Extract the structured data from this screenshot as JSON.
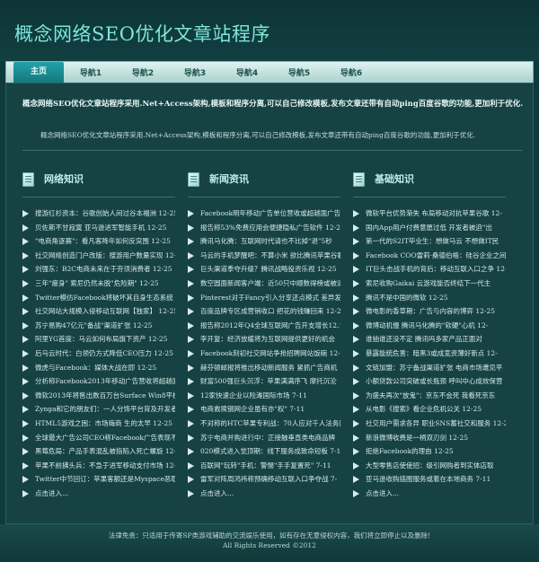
{
  "site": {
    "title": "概念网络SEO优化文章站程序"
  },
  "nav": [
    {
      "label": "主页",
      "active": true
    },
    {
      "label": "导航1"
    },
    {
      "label": "导航2"
    },
    {
      "label": "导航3"
    },
    {
      "label": "导航4"
    },
    {
      "label": "导航5"
    },
    {
      "label": "导航6"
    }
  ],
  "intro": {
    "bold": "概念网络SEO优化文章站程序采用.Net+Access架构,模板和程序分离,可以自己修改模板,发布文章还带有自动ping百度谷歌的功能,更加利于优化.",
    "plain": "概念网络SEO优化文章站程序采用.Net+Access架构,模板和程序分离,可以自己修改模板,发布文章还带有自动ping百度谷歌的功能,更加利于优化."
  },
  "columns": [
    {
      "title": "网络知识",
      "items": [
        "搜游红杉资本：谷歌创始人间过谷本福洲 12-25",
        "贝佐斯不甘寂寞 亚马逊进军智能手机 12-25",
        "\"电商角逐赛\"：看凡客降年如何反突围 12-25",
        "社交网络创造门户改版：搜游用户数量实现 12-",
        "刘强东：B2C电商未来在于夯须消费者 12-25",
        "三年\"瘦身\" 索尼仍然未脱\"危险期\" 12-25",
        "Twitter模仿Facebook将破坏其自身生态系统",
        "社交网站大规模入侵移动互联网【独家】 12-25",
        "苏宁易购47亿元\"备战\"渠道扩张 12-25",
        "阿里YG首度：马云如何布局旗下资产 12-25",
        "后马云时代：白领仍方式降低CEO压力 12-25",
        "微虎与Facebook：媒体大战在即 12-25",
        "分析称Facebook2013年移动广告营收将超越面",
        "微软2013年将售出数百万台Surface Win8平板",
        "Zynga和它的朋友们：一人分饰平台背及开发者",
        "HTML5游戏之困：市场嗨商 生的太早 12-25",
        "全球最大广告公司CEO称Facebook广告表现不佳",
        "黑莓危局：产品手表混乱被指陷入死亡螺旋 12-",
        "苹果不前拂头兵：不急于进军移动支付市场 12-25",
        "Twitter中节回订：苹果客额还是Myspace恶取",
        "点击进入..."
      ]
    },
    {
      "title": "新闻资讯",
      "items": [
        "Facebook明年移动广告单位营收或超越面广告",
        "报告称53%免费应用会便捷隐私广告软件 12-25",
        "腾讯马化腾：互联网时代请也不比掉\"退\"5秒",
        "马云的手机梦醒吧：不算小米 欲比腾讯苹果谷歌",
        "巨头渠道季夺升级？腾讯战略投资乐视 12-25",
        "数空圆面新闻客户端：近50只中顺数得榜或被清",
        "Pinterest对于Fancy引入分享还点模式 差异发",
        "百度品牌专区成营销收口 把花的钱赚回来 12-25",
        "报告称2012年Q4全球互联网广告开支增长12.1%",
        "李开复：经济放缓将为互联网提供更好的机会",
        "Facebook刻初社交网站争抢招聘网站饭碗 12-25",
        "赫芬顿邮报将推出移动新闻服务 紧抓广告商机",
        "财富500强巨头沉浮：苹果满满序飞 摩托沉沦",
        "12家快速企业以险滩国际市场 7-11",
        "电商救赎钢网企业虽有亦\"权\" 7-11",
        "不对称的HTC苹果专利战：70人应对千人法务团",
        "苏宁电商并购进行中：正接触垂直类电商品牌",
        "020模式进入觉顶期：线下服务成致命短板 7-11",
        "百联网\"玩转\"手机：警惕\"手手复置死\" 7-11",
        "雷军对阵周鸿祎称预确移动互联入口争夺战 7-",
        "点击进入..."
      ]
    },
    {
      "title": "基础知识",
      "items": [
        "微软平台优势渐失 布局移动对抗苹果谷歌 12-",
        "国内App用户付费意愿过低 开发者被迫\"出",
        "第一代的S2IT毕业生：想做马云 不想做IT民",
        "Facebook COO雷莉·桑德伯格：硅谷企业之间应",
        "IT巨头击战手机的背后：移动互联入口之争 12-",
        "索尼收购Gaikai 云游戏能否终结下一代主",
        "腾讯不是中国的微软 12-25",
        "微电影的香草期：广告与内容的博弈 12-25",
        "微博动机慢 腾讯马化腾的\"软硬\"心机 12-",
        "谁抽谁还没不定 腾讯吗多家产品正面对",
        "暴露能统危害：暗黑3或成宽资薄好新点 12-",
        "文链加盟：苏宁备战渠道扩张 电商市场遭见平",
        "小额贷款公司突破或长瓶颈 呼叫中心成效保营",
        "为盛夫再次\"放鬼\"：京东不会死 我看死京东",
        "从电影《搜索》看企业危机公关 12-25",
        "社交用户需求各异 职业SNS蓄社交和服务 12-25",
        "新浪微博收费是一柄双刃剑 12-25",
        "拒绝Facebook的理由 12-25",
        "大型零售店使使招：级引网购者到实体店取",
        "亚马逊收购插图服务或着在本地商务 7-11",
        "点击进入..."
      ]
    }
  ],
  "footer": {
    "line1": "法律免责：只适用于传寄SP类游戏辅助的交流娱乐使用，如有存在无意侵权内容，我们将立即停止以及删除!",
    "line2": "All Rights Reserved ©2012"
  }
}
